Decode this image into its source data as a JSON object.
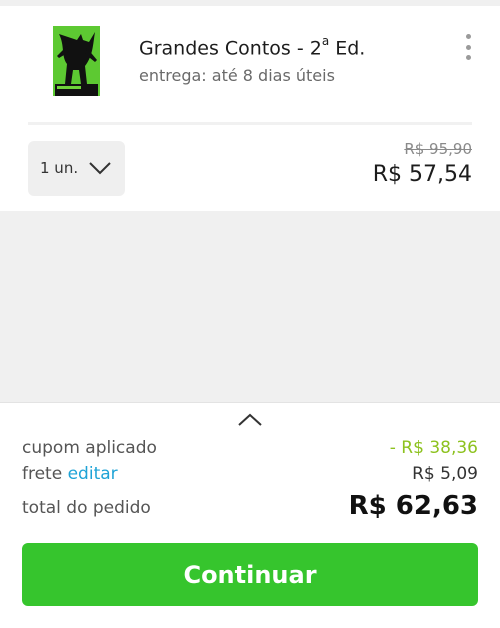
{
  "product": {
    "title_main": "Grandes Contos - 2",
    "title_sup": "a",
    "title_suffix": " Ed.",
    "delivery": "entrega: até 8 dias úteis",
    "cover_icon": "book-cover-monster-image",
    "quantity": "1 un.",
    "old_price": "R$ 95,90",
    "price": "R$ 57,54"
  },
  "summary": {
    "coupon_label": "cupom aplicado",
    "coupon_value": "- R$ 38,36",
    "shipping_label": "frete",
    "shipping_edit": "editar",
    "shipping_value": "R$ 5,09",
    "total_label": "total do pedido",
    "total_value": "R$ 62,63"
  },
  "actions": {
    "continue_label": "Continuar"
  },
  "colors": {
    "accent_green": "#36c52d",
    "discount_green": "#8dc21f",
    "link_blue": "#1ea3d6"
  }
}
